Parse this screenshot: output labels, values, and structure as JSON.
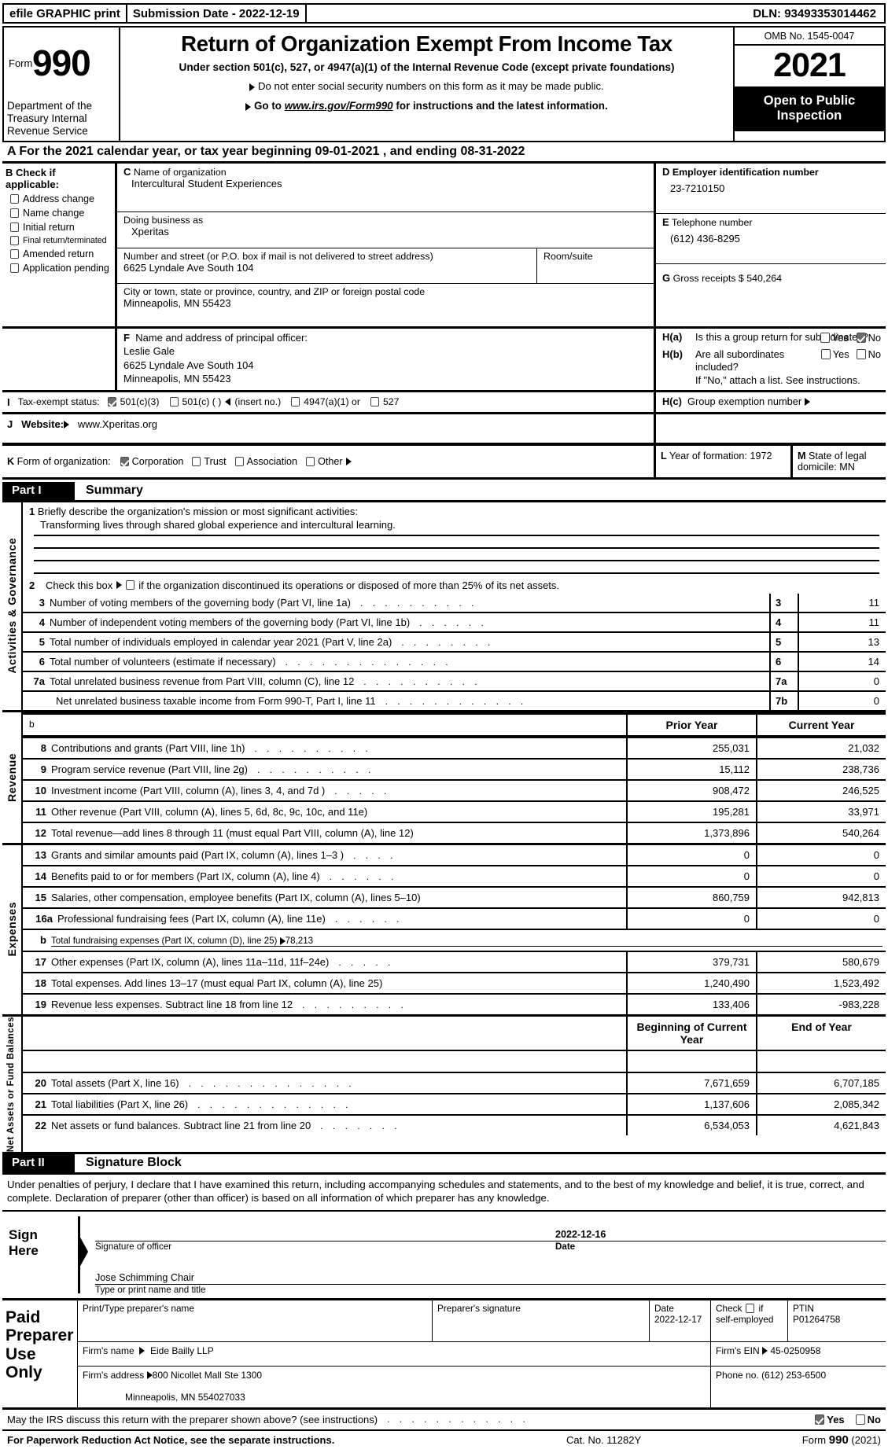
{
  "efile": {
    "print_label": "efile GRAPHIC print",
    "submission_label": "Submission Date - 2022-12-19",
    "dln": "DLN: 93493353014462"
  },
  "masthead": {
    "form_word": "Form",
    "form_number": "990",
    "department": "Department of the Treasury Internal Revenue Service",
    "title": "Return of Organization Exempt From Income Tax",
    "subtitle": "Under section 501(c), 527, or 4947(a)(1) of the Internal Revenue Code (except private foundations)",
    "note1": "Do not enter social security numbers on this form as it may be made public.",
    "note2_pre": "Go to",
    "note2_url": "www.irs.gov/Form990",
    "note2_post": "for instructions and the latest information.",
    "omb": "OMB No. 1545-0047",
    "year": "2021",
    "open_to_public": "Open to Public Inspection"
  },
  "lineA": "A  For the 2021 calendar year, or tax year beginning 09-01-2021    , and ending 08-31-2022",
  "sectionB": {
    "heading": "B  Check if applicable:",
    "items": [
      {
        "label": "Address change",
        "checked": false
      },
      {
        "label": "Name change",
        "checked": false
      },
      {
        "label": "Initial return",
        "checked": false
      },
      {
        "label": "Final return/terminated",
        "checked": false,
        "small": true
      },
      {
        "label": "Amended return",
        "checked": false
      },
      {
        "label": "Application pending",
        "checked": false
      }
    ]
  },
  "sectionC": {
    "name_label": "Name of organization",
    "name_value": "Intercultural Student Experiences",
    "dba_label": "Doing business as",
    "dba_value": "Xperitas",
    "street_label": "Number and street (or P.O. box if mail is not delivered to street address)",
    "street_value": "6625 Lyndale Ave South 104",
    "room_label": "Room/suite",
    "room_value": "",
    "city_label": "City or town, state or province, country, and ZIP or foreign postal code",
    "city_value": "Minneapolis, MN   55423"
  },
  "sectionD": {
    "label": "Employer identification number",
    "value": "23-7210150"
  },
  "sectionE": {
    "label": "Telephone number",
    "value": "(612) 436-8295"
  },
  "sectionG": {
    "label": "Gross receipts $",
    "value": "540,264"
  },
  "sectionF": {
    "label": "Name and address of principal officer:",
    "lines": [
      "Leslie Gale",
      "6625 Lyndale Ave South 104",
      "Minneapolis, MN   55423"
    ]
  },
  "sectionH": {
    "a_tag": "H(a)",
    "a_text": "Is this a group return for subordinates?",
    "a_yes": "Yes",
    "a_no": "No",
    "a_yes_checked": false,
    "a_no_checked": true,
    "b_tag": "H(b)",
    "b_text": "Are all subordinates included?",
    "b_yes": "Yes",
    "b_no": "No",
    "b_yes_checked": false,
    "b_no_checked": false,
    "b_note": "If \"No,\" attach a list. See instructions.",
    "c_tag": "H(c)",
    "c_text": "Group exemption number"
  },
  "sectionI": {
    "label": "Tax-exempt status:",
    "options": [
      {
        "label": "501(c)(3)",
        "checked": true
      },
      {
        "label": "501(c) (   )",
        "checked": false,
        "suffix": "(insert no.)"
      },
      {
        "label": "4947(a)(1) or",
        "checked": false
      },
      {
        "label": "527",
        "checked": false
      }
    ]
  },
  "sectionJ": {
    "label": "Website:",
    "value": "www.Xperitas.org"
  },
  "sectionK": {
    "label": "Form of organization:",
    "options": [
      {
        "label": "Corporation",
        "checked": true
      },
      {
        "label": "Trust",
        "checked": false
      },
      {
        "label": "Association",
        "checked": false
      },
      {
        "label": "Other",
        "checked": false,
        "arrow": true
      }
    ]
  },
  "sectionL": {
    "label": "Year of formation:",
    "value": "1972"
  },
  "sectionM": {
    "label": "State of legal domicile:",
    "value": "MN"
  },
  "partI": {
    "tag": "Part I",
    "title": "Summary",
    "side_activities": "Activities & Governance",
    "side_revenue": "Revenue",
    "side_expenses": "Expenses",
    "side_netassets": "Net Assets or Fund Balances",
    "line1_label": "Briefly describe the organization's mission or most significant activities:",
    "line1_value": "Transforming lives through shared global experience and intercultural learning.",
    "line2_pre": "Check this box",
    "line2_post": "if the organization discontinued its operations or disposed of more than 25% of its net assets.",
    "line2_checked": false,
    "gov_rows": [
      {
        "num": "3",
        "label": "Number of voting members of the governing body (Part VI, line 1a)",
        "box": "3",
        "value": "11",
        "dots": 10
      },
      {
        "num": "4",
        "label": "Number of independent voting members of the governing body (Part VI, line 1b)",
        "box": "4",
        "value": "11",
        "dots": 6
      },
      {
        "num": "5",
        "label": "Total number of individuals employed in calendar year 2021 (Part V, line 2a)",
        "box": "5",
        "value": "13",
        "dots": 8
      },
      {
        "num": "6",
        "label": "Total number of volunteers (estimate if necessary)",
        "box": "6",
        "value": "14",
        "dots": 14
      },
      {
        "num": "7a",
        "label": "Total unrelated business revenue from Part VIII, column (C), line 12",
        "box": "7a",
        "value": "0",
        "dots": 10
      },
      {
        "num": "",
        "label": "Net unrelated business taxable income from Form 990-T, Part I, line 11",
        "box": "7b",
        "value": "0",
        "dots": 12
      }
    ],
    "col_prior": "Prior Year",
    "col_current": "Current Year",
    "revenue_rows": [
      {
        "num": "8",
        "label": "Contributions and grants (Part VIII, line 1h)",
        "dots": 10,
        "prior": "255,031",
        "current": "21,032"
      },
      {
        "num": "9",
        "label": "Program service revenue (Part VIII, line 2g)",
        "dots": 10,
        "prior": "15,112",
        "current": "238,736"
      },
      {
        "num": "10",
        "label": "Investment income (Part VIII, column (A), lines 3, 4, and 7d )",
        "dots": 5,
        "prior": "908,472",
        "current": "246,525"
      },
      {
        "num": "11",
        "label": "Other revenue (Part VIII, column (A), lines 5, 6d, 8c, 9c, 10c, and 11e)",
        "dots": 0,
        "prior": "195,281",
        "current": "33,971"
      },
      {
        "num": "12",
        "label": "Total revenue—add lines 8 through 11 (must equal Part VIII, column (A), line 12)",
        "dots": 0,
        "prior": "1,373,896",
        "current": "540,264"
      }
    ],
    "expense_rows": [
      {
        "num": "13",
        "label": "Grants and similar amounts paid (Part IX, column (A), lines 1–3 )",
        "dots": 4,
        "prior": "0",
        "current": "0"
      },
      {
        "num": "14",
        "label": "Benefits paid to or for members (Part IX, column (A), line 4)",
        "dots": 6,
        "prior": "0",
        "current": "0"
      },
      {
        "num": "15",
        "label": "Salaries, other compensation, employee benefits (Part IX, column (A), lines 5–10)",
        "dots": 0,
        "prior": "860,759",
        "current": "942,813"
      },
      {
        "num": "16a",
        "label": "Professional fundraising fees (Part IX, column (A), line 11e)",
        "dots": 6,
        "prior": "0",
        "current": "0"
      }
    ],
    "fundraising_row": {
      "num": "b",
      "label": "Total fundraising expenses (Part IX, column (D), line 25)",
      "value": "78,213"
    },
    "expense_rows2": [
      {
        "num": "17",
        "label": "Other expenses (Part IX, column (A), lines 11a–11d, 11f–24e)",
        "dots": 5,
        "prior": "379,731",
        "current": "580,679"
      },
      {
        "num": "18",
        "label": "Total expenses. Add lines 13–17 (must equal Part IX, column (A), line 25)",
        "dots": 0,
        "prior": "1,240,490",
        "current": "1,523,492"
      },
      {
        "num": "19",
        "label": "Revenue less expenses. Subtract line 18 from line 12",
        "dots": 9,
        "prior": "133,406",
        "current": "-983,228"
      }
    ],
    "col_begin": "Beginning of Current Year",
    "col_end": "End of Year",
    "netasset_rows": [
      {
        "num": "20",
        "label": "Total assets (Part X, line 16)",
        "dots": 14,
        "prior": "7,671,659",
        "current": "6,707,185"
      },
      {
        "num": "21",
        "label": "Total liabilities (Part X, line 26)",
        "dots": 13,
        "prior": "1,137,606",
        "current": "2,085,342"
      },
      {
        "num": "22",
        "label": "Net assets or fund balances. Subtract line 21 from line 20",
        "dots": 7,
        "prior": "6,534,053",
        "current": "4,621,843"
      }
    ]
  },
  "partII": {
    "tag": "Part II",
    "title": "Signature Block",
    "perjury": "Under penalties of perjury, I declare that I have examined this return, including accompanying schedules and statements, and to the best of my knowledge and belief, it is true, correct, and complete. Declaration of preparer (other than officer) is based on all information of which preparer has any knowledge.",
    "sign_here": "Sign Here",
    "officer_date": "2022-12-16",
    "sig_officer_caption": "Signature of officer",
    "date_caption": "Date",
    "officer_name_title": "Jose Schimming  Chair",
    "type_print_caption": "Type or print name and title"
  },
  "preparer": {
    "block_label": "Paid Preparer Use Only",
    "name_caption": "Print/Type preparer's name",
    "name_value": "",
    "sig_caption": "Preparer's signature",
    "sig_value": "",
    "date_caption": "Date",
    "date_value": "2022-12-17",
    "check_caption_pre": "Check",
    "check_caption_post": "if",
    "check_caption_2": "self-employed",
    "self_employed_checked": false,
    "ptin_caption": "PTIN",
    "ptin_value": "P01264758",
    "firm_name_caption": "Firm's name",
    "firm_name_value": "Eide Bailly LLP",
    "firm_ein_caption": "Firm's EIN",
    "firm_ein_value": "45-0250958",
    "firm_addr_caption": "Firm's address",
    "firm_addr_line1": "800 Nicollet Mall Ste 1300",
    "firm_addr_line2": "Minneapolis, MN   554027033",
    "phone_caption": "Phone no.",
    "phone_value": "(612) 253-6500"
  },
  "footer": {
    "irs_question": "May the IRS discuss this return with the preparer shown above? (see instructions)",
    "yes": "Yes",
    "no": "No",
    "yes_checked": true,
    "no_checked": false,
    "paperwork": "For Paperwork Reduction Act Notice, see the separate instructions.",
    "cat_no": "Cat. No. 11282Y",
    "form_pre": "Form",
    "form_num": "990",
    "form_year": "(2021)"
  }
}
